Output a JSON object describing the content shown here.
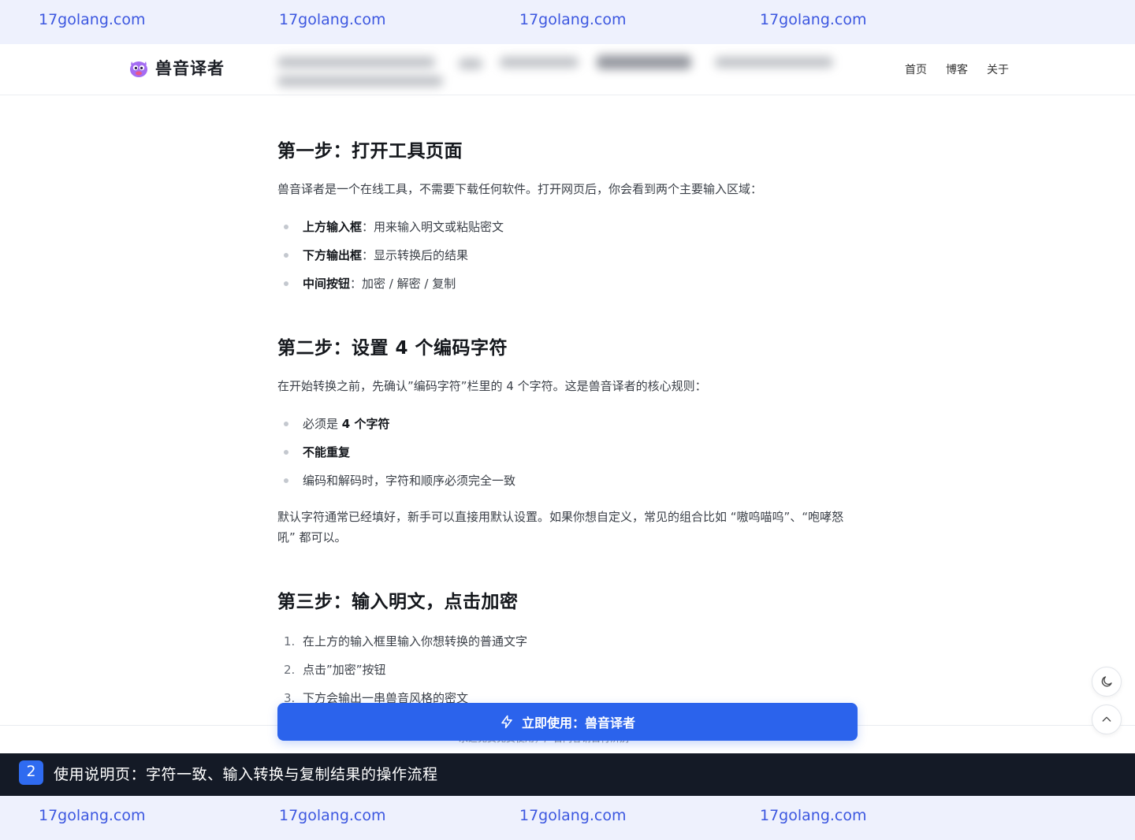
{
  "watermark": {
    "text": "17golang.com"
  },
  "navbar": {
    "logo_text": "兽音译者",
    "links": [
      "首页",
      "博客",
      "关于"
    ]
  },
  "article": {
    "step1": {
      "heading": "第一步：打开工具页面",
      "intro": "兽音译者是一个在线工具，不需要下载任何软件。打开网页后，你会看到两个主要输入区域：",
      "items": [
        {
          "bold": "上方输入框",
          "text": "：用来输入明文或粘贴密文"
        },
        {
          "bold": "下方输出框",
          "text": "：显示转换后的结果"
        },
        {
          "bold": "中间按钮",
          "text": "：加密 / 解密 / 复制"
        }
      ]
    },
    "step2": {
      "heading": "第二步：设置 4 个编码字符",
      "intro": "在开始转换之前，先确认”编码字符”栏里的 4 个字符。这是兽音译者的核心规则：",
      "items": [
        {
          "pre": "必须是 ",
          "bold": "4 个字符"
        },
        {
          "bold": "不能重复"
        },
        {
          "text": "编码和解码时，字符和顺序必须完全一致"
        }
      ],
      "note": "默认字符通常已经填好，新手可以直接用默认设置。如果你想自定义，常见的组合比如 “嗷呜喵呜”、“咆哮怒吼” 都可以。"
    },
    "step3": {
      "heading": "第三步：输入明文，点击加密",
      "items": [
        {
          "num": "1.",
          "text": "在上方的输入框里输入你想转换的普通文字"
        },
        {
          "num": "2.",
          "text": "点击”加密”按钮"
        },
        {
          "num": "3.",
          "text": "下方会输出一串兽音风格的密文"
        }
      ]
    }
  },
  "cta": {
    "label": "立即使用：兽音译者"
  },
  "footer": {
    "peek_text": "永远免费免费使用，广告内容请自行辨别"
  },
  "caption": {
    "badge": "2",
    "text": "使用说明页：字符一致、输入转换与复制结果的操作流程"
  },
  "colors": {
    "accent": "#2b63ec",
    "watermark": "#3c57e0",
    "caption_bg": "#141a26"
  }
}
